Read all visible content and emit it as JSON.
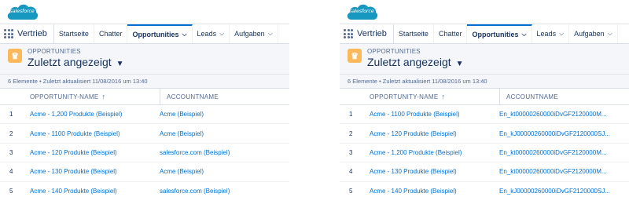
{
  "panels": [
    {
      "logo_text": "salesforce",
      "app_name": "Vertrieb",
      "nav": [
        {
          "label": "Startseite",
          "active": false,
          "chevron": false
        },
        {
          "label": "Chatter",
          "active": false,
          "chevron": false
        },
        {
          "label": "Opportunities",
          "active": true,
          "chevron": true
        },
        {
          "label": "Leads",
          "active": false,
          "chevron": true
        },
        {
          "label": "Aufgaben",
          "active": false,
          "chevron": true
        }
      ],
      "object_label": "OPPORTUNITIES",
      "list_title": "Zuletzt angezeigt",
      "status": "6 Elemente • Zuletzt aktualisiert 11/08/2016 um 13:40",
      "columns": {
        "opp": "OPPORTUNITY-NAME",
        "acc": "ACCOUNTNAME"
      },
      "rows": [
        {
          "num": "1",
          "opp": "Acme - 1,200 Produkte (Beispiel)",
          "acc": "Acme (Beispiel)"
        },
        {
          "num": "2",
          "opp": "Acme - 1100 Produkte (Beispiel)",
          "acc": "Acme (Beispiel)"
        },
        {
          "num": "3",
          "opp": "Acme - 120 Produkte (Beispiel)",
          "acc": "salesforce.com (Beispiel)"
        },
        {
          "num": "4",
          "opp": "Acme - 130 Produkte (Beispiel)",
          "acc": "Acme (Beispiel)"
        },
        {
          "num": "5",
          "opp": "Acme - 140 Produkte (Beispiel)",
          "acc": "salesforce.com (Beispiel)"
        }
      ]
    },
    {
      "logo_text": "salesforce",
      "app_name": "Vertrieb",
      "nav": [
        {
          "label": "Startseite",
          "active": false,
          "chevron": false
        },
        {
          "label": "Chatter",
          "active": false,
          "chevron": false
        },
        {
          "label": "Opportunities",
          "active": true,
          "chevron": true
        },
        {
          "label": "Leads",
          "active": false,
          "chevron": true
        },
        {
          "label": "Aufgaben",
          "active": false,
          "chevron": true
        }
      ],
      "object_label": "OPPORTUNITIES",
      "list_title": "Zuletzt angezeigt",
      "status": "6 Elemente • Zuletzt aktualisiert 11/08/2016 um 13:40",
      "columns": {
        "opp": "OPPORTUNITY-NAME",
        "acc": "ACCOUNTNAME"
      },
      "rows": [
        {
          "num": "1",
          "opp": "Acme - 1100 Produkte (Beispiel)",
          "acc": "En_kt00000260000iDvGF2120000M..."
        },
        {
          "num": "2",
          "opp": "Acme - 120 Produkte (Beispiel)",
          "acc": "En_kJ00000260000iDvGF2120000SJ..."
        },
        {
          "num": "3",
          "opp": "Acme - 1,200 Produkte (Beispiel)",
          "acc": "En_kt00000260000iDvGF2120000M..."
        },
        {
          "num": "4",
          "opp": "Acme - 130 Produkte (Beispiel)",
          "acc": "En_kt00000260000iDvGF2120000M..."
        },
        {
          "num": "5",
          "opp": "Acme - 140 Produkte (Beispiel)",
          "acc": "En_kJ00000260000iDvGF2120000SJ..."
        }
      ]
    }
  ],
  "colors": {
    "accent": "#0070d2",
    "object_icon": "#fcb95b",
    "logo": "#1798c1"
  },
  "icons": [
    "salesforce-logo",
    "app-launcher-icon",
    "chevron-down-icon",
    "crown-icon",
    "caret-down-icon",
    "sort-up-arrow-icon"
  ]
}
